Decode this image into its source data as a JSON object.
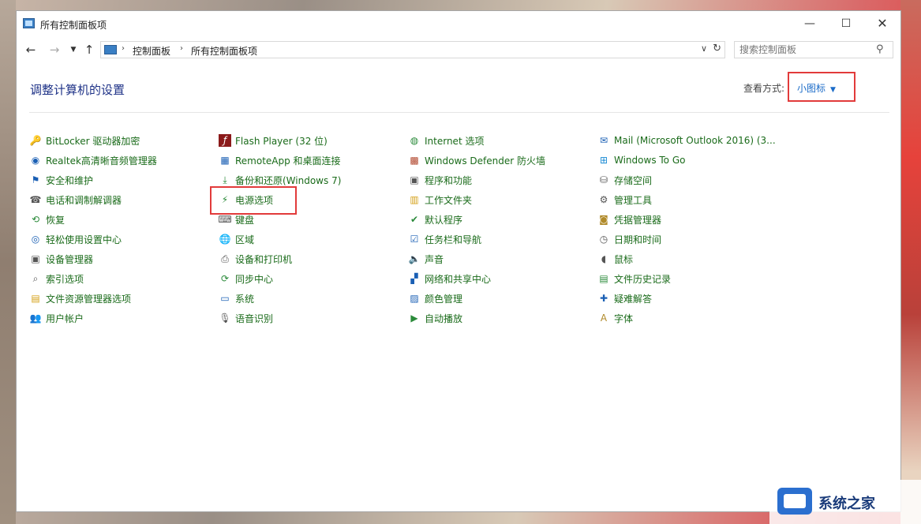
{
  "window": {
    "title": "所有控制面板项"
  },
  "navigation": {
    "breadcrumb": [
      "控制面板",
      "所有控制面板项"
    ],
    "search_placeholder": "搜索控制面板"
  },
  "content": {
    "heading": "调整计算机的设置",
    "view_label": "查看方式:",
    "view_value": "小图标"
  },
  "items": {
    "col1": [
      {
        "label": "BitLocker 驱动器加密",
        "icon": "bitlocker-key-icon"
      },
      {
        "label": "Realtek高清晰音频管理器",
        "icon": "realtek-speaker-icon"
      },
      {
        "label": "安全和维护",
        "icon": "flag-icon"
      },
      {
        "label": "电话和调制解调器",
        "icon": "phone-modem-icon"
      },
      {
        "label": "恢复",
        "icon": "recovery-icon"
      },
      {
        "label": "轻松使用设置中心",
        "icon": "ease-of-access-icon"
      },
      {
        "label": "设备管理器",
        "icon": "device-manager-icon"
      },
      {
        "label": "索引选项",
        "icon": "indexing-icon"
      },
      {
        "label": "文件资源管理器选项",
        "icon": "folder-options-icon"
      },
      {
        "label": "用户帐户",
        "icon": "user-accounts-icon"
      }
    ],
    "col2": [
      {
        "label": "Flash Player (32 位)",
        "icon": "flash-icon"
      },
      {
        "label": "RemoteApp 和桌面连接",
        "icon": "remoteapp-icon"
      },
      {
        "label": "备份和还原(Windows 7)",
        "icon": "backup-icon"
      },
      {
        "label": "电源选项",
        "icon": "power-options-icon"
      },
      {
        "label": "键盘",
        "icon": "keyboard-icon"
      },
      {
        "label": "区域",
        "icon": "region-globe-icon"
      },
      {
        "label": "设备和打印机",
        "icon": "printer-icon"
      },
      {
        "label": "同步中心",
        "icon": "sync-icon"
      },
      {
        "label": "系统",
        "icon": "system-monitor-icon"
      },
      {
        "label": "语音识别",
        "icon": "microphone-icon"
      }
    ],
    "col3": [
      {
        "label": "Internet 选项",
        "icon": "internet-options-icon"
      },
      {
        "label": "Windows Defender 防火墙",
        "icon": "firewall-icon"
      },
      {
        "label": "程序和功能",
        "icon": "programs-icon"
      },
      {
        "label": "工作文件夹",
        "icon": "work-folders-icon"
      },
      {
        "label": "默认程序",
        "icon": "default-programs-icon"
      },
      {
        "label": "任务栏和导航",
        "icon": "taskbar-icon"
      },
      {
        "label": "声音",
        "icon": "sound-icon"
      },
      {
        "label": "网络和共享中心",
        "icon": "network-icon"
      },
      {
        "label": "颜色管理",
        "icon": "color-management-icon"
      },
      {
        "label": "自动播放",
        "icon": "autoplay-icon"
      }
    ],
    "col4": [
      {
        "label": "Mail (Microsoft Outlook 2016) (3...",
        "icon": "mail-icon"
      },
      {
        "label": "Windows To Go",
        "icon": "windows-logo-icon"
      },
      {
        "label": "存储空间",
        "icon": "storage-icon"
      },
      {
        "label": "管理工具",
        "icon": "admin-tools-icon"
      },
      {
        "label": "凭据管理器",
        "icon": "credential-icon"
      },
      {
        "label": "日期和时间",
        "icon": "calendar-clock-icon"
      },
      {
        "label": "鼠标",
        "icon": "mouse-icon"
      },
      {
        "label": "文件历史记录",
        "icon": "file-history-icon"
      },
      {
        "label": "疑难解答",
        "icon": "troubleshoot-icon"
      },
      {
        "label": "字体",
        "icon": "font-icon"
      }
    ]
  },
  "watermark": {
    "text": "系统之家"
  }
}
